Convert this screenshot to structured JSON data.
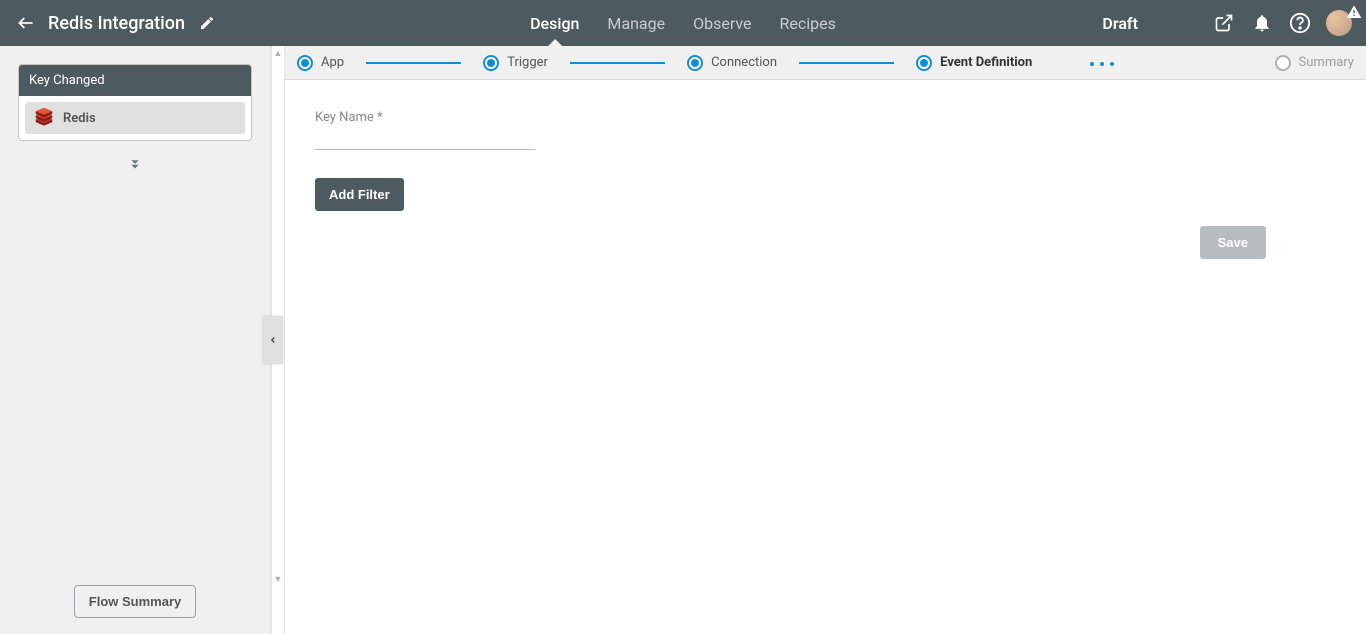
{
  "header": {
    "title": "Redis Integration",
    "tabs": [
      {
        "label": "Design",
        "active": true
      },
      {
        "label": "Manage",
        "active": false
      },
      {
        "label": "Observe",
        "active": false
      },
      {
        "label": "Recipes",
        "active": false
      }
    ],
    "status": "Draft"
  },
  "sidebar": {
    "card_title": "Key Changed",
    "app_name": "Redis",
    "flow_summary_btn": "Flow Summary"
  },
  "steps": [
    {
      "label": "App",
      "state": "done"
    },
    {
      "label": "Trigger",
      "state": "done"
    },
    {
      "label": "Connection",
      "state": "done"
    },
    {
      "label": "Event Definition",
      "state": "current"
    },
    {
      "label": "Summary",
      "state": "pending"
    }
  ],
  "form": {
    "key_name_label": "Key Name *",
    "add_filter_btn": "Add Filter",
    "save_btn": "Save"
  }
}
